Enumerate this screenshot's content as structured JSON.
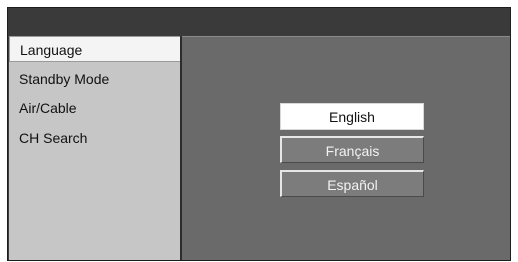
{
  "menu": {
    "items": [
      {
        "label": "Language",
        "selected": true
      },
      {
        "label": "Standby Mode",
        "selected": false
      },
      {
        "label": "Air/Cable",
        "selected": false
      },
      {
        "label": "CH Search",
        "selected": false
      }
    ]
  },
  "language_options": {
    "items": [
      {
        "label": "English",
        "selected": true
      },
      {
        "label": "Français",
        "selected": false
      },
      {
        "label": "Español",
        "selected": false
      }
    ]
  },
  "colors": {
    "screen_background": "#3c3c3c",
    "menu_background": "#c6c6c6",
    "menu_selected_background": "#f4f4f4",
    "content_background": "#6a6a6a",
    "option_selected_background": "#ffffff",
    "option_unselected_background": "#7c7c7c"
  }
}
